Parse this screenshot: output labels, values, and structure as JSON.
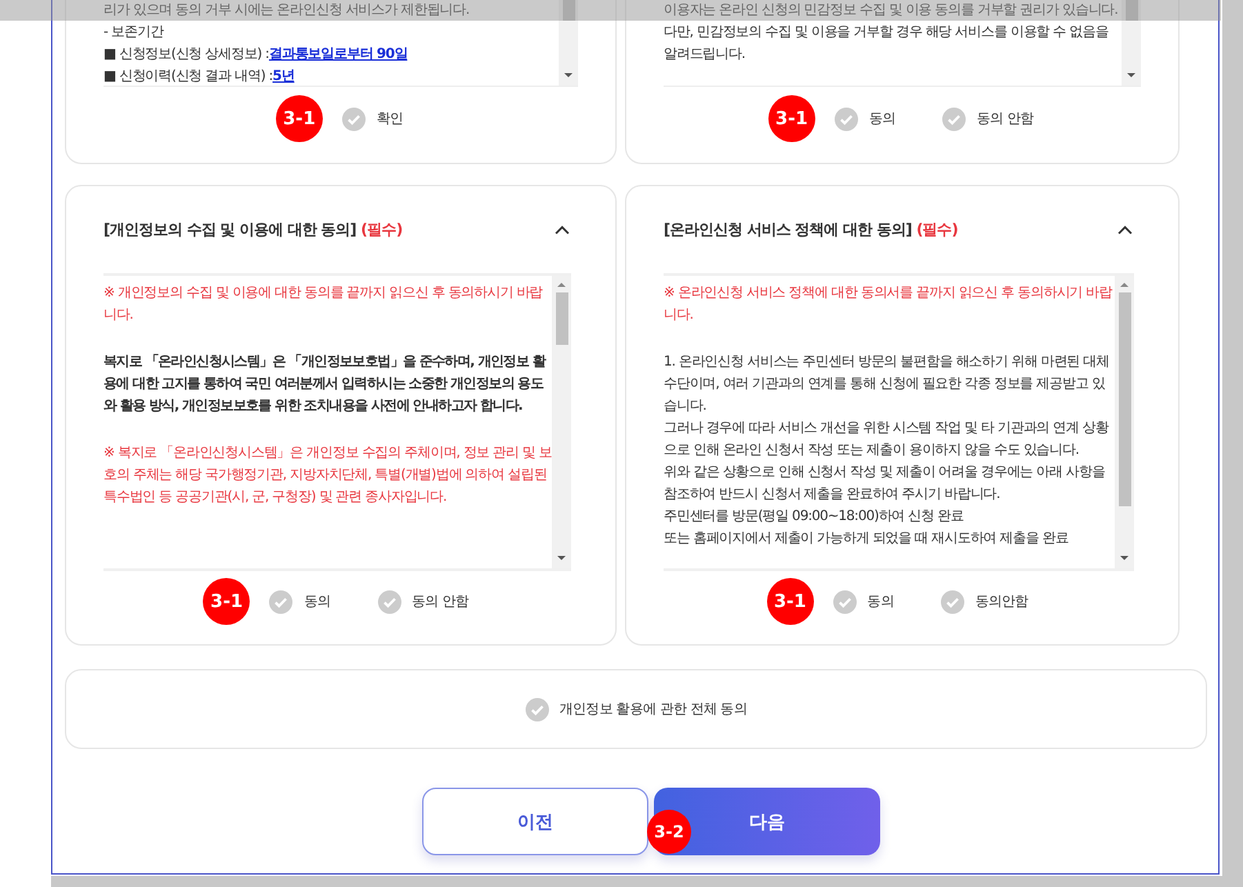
{
  "top_cards": [
    {
      "lines": [
        {
          "kind": "text",
          "text": "리가 있으며 동의 거부 시에는 온라인신청 서비스가 제한됩니다."
        },
        {
          "kind": "text",
          "text": "- 보존기간"
        },
        {
          "kind": "item",
          "text": "■ 신청정보(신청 상세정보) :",
          "link": "결과통보일로부터 90일"
        },
        {
          "kind": "item",
          "text": "■ 신청이력(신청 결과 내역) :",
          "link": "5년"
        }
      ],
      "badge": "3-1",
      "options": [
        {
          "label": "확인",
          "checked": false
        }
      ]
    },
    {
      "lines": [
        {
          "kind": "text",
          "text": "이용자는 온라인 신청의 민감정보 수집 및 이용 동의를 거부할 권리가 있습니다."
        },
        {
          "kind": "text",
          "text": "다만, 민감정보의 수집 및 이용을 거부할 경우 해당 서비스를 이용할 수 없음을"
        },
        {
          "kind": "text",
          "text": "알려드립니다."
        }
      ],
      "badge": "3-1",
      "options": [
        {
          "label": "동의",
          "checked": false
        },
        {
          "label": "동의 안함",
          "checked": false
        }
      ]
    }
  ],
  "cards": [
    {
      "title": "[개인정보의 수집 및 이용에 대한 동의]",
      "required": "(필수)",
      "expanded": true,
      "paragraphs": [
        {
          "kind": "notice",
          "text": "※ 개인정보의 수집 및 이용에 대한 동의를 끝까지 읽으신 후 동의하시기 바랍니다."
        },
        {
          "kind": "bold",
          "text": "복지로 「온라인신청시스템」은 「개인정보보호법」을 준수하며, 개인정보 활용에 대한 고지를 통하여 국민 여러분께서 입력하시는 소중한 개인정보의 용도와 활용 방식, 개인정보보호를 위한 조치내용을 사전에 안내하고자 합니다."
        },
        {
          "kind": "notice",
          "text": "※ 복지로 「온라인신청시스템」은 개인정보 수집의 주체이며, 정보 관리 및 보호의 주체는 해당 국가행정기관, 지방자치단체, 특별(개별)법에 의하여 설립된 특수법인 등 공공기관(시, 군, 구청장) 및 관련 종사자입니다."
        }
      ],
      "badge": "3-1",
      "options": [
        {
          "label": "동의",
          "checked": false
        },
        {
          "label": "동의 안함",
          "checked": false
        }
      ]
    },
    {
      "title": "[온라인신청 서비스 정책에 대한 동의]",
      "required": "(필수)",
      "expanded": true,
      "paragraphs": [
        {
          "kind": "notice",
          "text": "※ 온라인신청 서비스 정책에 대한 동의서를 끝까지 읽으신 후 동의하시기 바랍니다."
        },
        {
          "kind": "plain",
          "text": "1. 온라인신청 서비스는 주민센터 방문의 불편함을 해소하기 위해 마련된 대체 수단이며, 여러 기관과의 연계를 통해 신청에 필요한 각종 정보를 제공받고 있습니다."
        },
        {
          "kind": "line",
          "text": "그러나 경우에 따라 서비스 개선을 위한 시스템 작업 및 타 기관과의 연계 상황으로 인해 온라인 신청서 작성 또는 제출이 용이하지 않을 수도 있습니다."
        },
        {
          "kind": "line",
          "text": "위와 같은 상황으로 인해 신청서 작성 및 제출이 어려울 경우에는 아래 사항을 참조하여 반드시 신청서 제출을 완료하여 주시기 바랍니다."
        },
        {
          "kind": "line",
          "text": "주민센터를 방문(평일 09:00~18:00)하여 신청 완료"
        },
        {
          "kind": "line",
          "text": "또는 홈페이지에서 제출이 가능하게 되었을 때 재시도하여 제출을 완료"
        }
      ],
      "badge": "3-1",
      "options": [
        {
          "label": "동의",
          "checked": false
        },
        {
          "label": "동의안함",
          "checked": false
        }
      ]
    }
  ],
  "all_agree": {
    "label": "개인정보 활용에 관한 전체 동의",
    "checked": false
  },
  "buttons": [
    {
      "label": "이전",
      "kind": "secondary"
    },
    {
      "label": "다음",
      "kind": "primary"
    }
  ],
  "button_badge": "3-2"
}
